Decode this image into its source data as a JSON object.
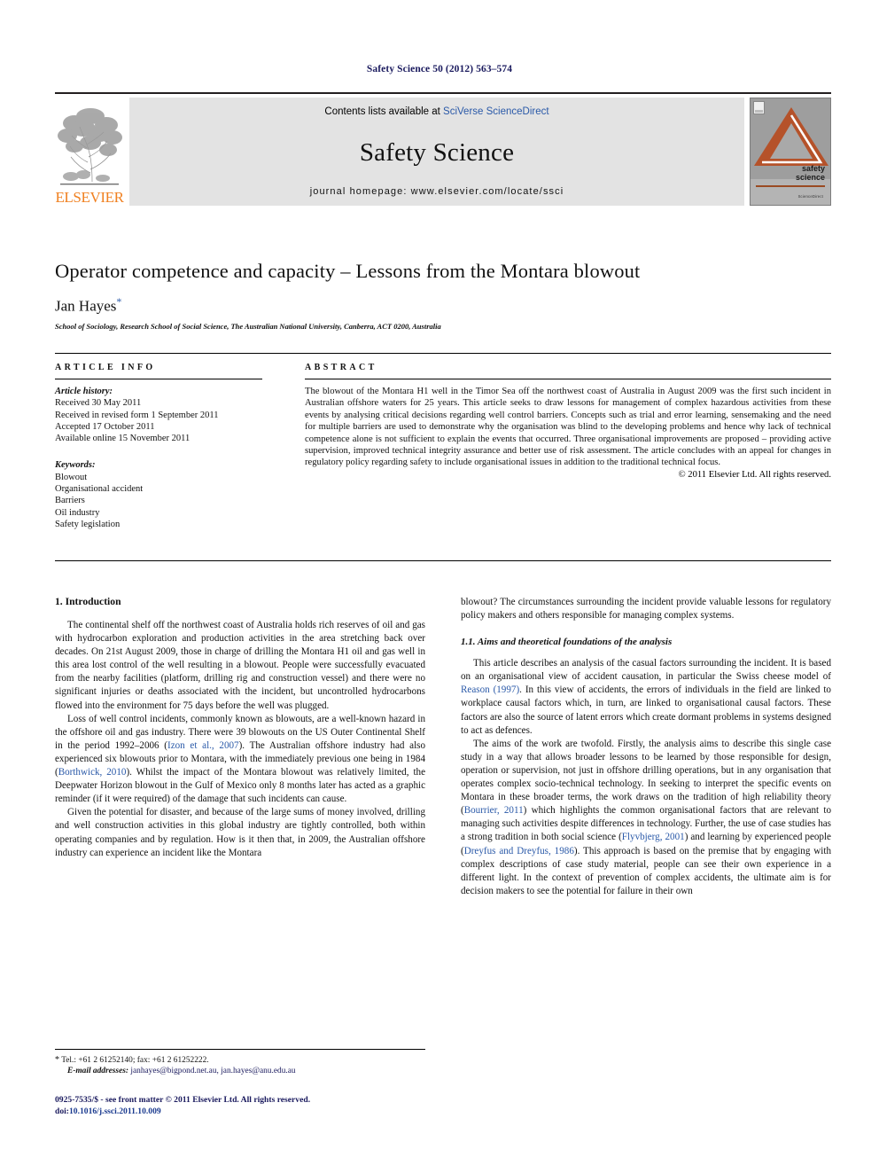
{
  "running_head": "Safety Science 50 (2012) 563–574",
  "banner": {
    "publisher_logo_name": "elsevier-tree-logo",
    "publisher_wordmark": "ELSEVIER",
    "contents_prefix": "Contents lists available at ",
    "contents_link": "SciVerse ScienceDirect",
    "journal_name": "Safety Science",
    "homepage_label": "journal homepage: www.elsevier.com/locate/ssci",
    "cover": {
      "title_line1": "safety",
      "title_line2": "science",
      "footer": "ScienceDirect"
    }
  },
  "article": {
    "title": "Operator competence and capacity – Lessons from the Montara blowout",
    "authors": "Jan Hayes",
    "corresponding_marker": "*",
    "affiliation": "School of Sociology, Research School of Social Science, The Australian National University, Canberra, ACT 0200, Australia"
  },
  "article_info": {
    "heading": "ARTICLE INFO",
    "history_label": "Article history:",
    "history": [
      "Received 30 May 2011",
      "Received in revised form 1 September 2011",
      "Accepted 17 October 2011",
      "Available online 15 November 2011"
    ],
    "keywords_label": "Keywords:",
    "keywords": [
      "Blowout",
      "Organisational accident",
      "Barriers",
      "Oil industry",
      "Safety legislation"
    ]
  },
  "abstract": {
    "heading": "ABSTRACT",
    "text": "The blowout of the Montara H1 well in the Timor Sea off the northwest coast of Australia in August 2009 was the first such incident in Australian offshore waters for 25 years. This article seeks to draw lessons for management of complex hazardous activities from these events by analysing critical decisions regarding well control barriers. Concepts such as trial and error learning, sensemaking and the need for multiple barriers are used to demonstrate why the organisation was blind to the developing problems and hence why lack of technical competence alone is not sufficient to explain the events that occurred. Three organisational improvements are proposed – providing active supervision, improved technical integrity assurance and better use of risk assessment. The article concludes with an appeal for changes in regulatory policy regarding safety to include organisational issues in addition to the traditional technical focus.",
    "copyright": "© 2011 Elsevier Ltd. All rights reserved."
  },
  "body": {
    "section1_heading": "1. Introduction",
    "left_paragraphs": [
      "The continental shelf off the northwest coast of Australia holds rich reserves of oil and gas with hydrocarbon exploration and production activities in the area stretching back over decades. On 21st August 2009, those in charge of drilling the Montara H1 oil and gas well in this area lost control of the well resulting in a blowout. People were successfully evacuated from the nearby facilities (platform, drilling rig and construction vessel) and there were no significant injuries or deaths associated with the incident, but uncontrolled hydrocarbons flowed into the environment for 75 days before the well was plugged."
    ],
    "left_para2_a": "Loss of well control incidents, commonly known as blowouts, are a well-known hazard in the offshore oil and gas industry. There were 39 blowouts on the US Outer Continental Shelf in the period 1992–2006 (",
    "left_para2_cite1": "Izon et al., 2007",
    "left_para2_b": "). The Australian offshore industry had also experienced six blowouts prior to Montara, with the immediately previous one being in 1984 (",
    "left_para2_cite2": "Borthwick, 2010",
    "left_para2_c": "). Whilst the impact of the Montara blowout was relatively limited, the Deepwater Horizon blowout in the Gulf of Mexico only 8 months later has acted as a graphic reminder (if it were required) of the damage that such incidents can cause.",
    "left_para3": "Given the potential for disaster, and because of the large sums of money involved, drilling and well construction activities in this global industry are tightly controlled, both within operating companies and by regulation. How is it then that, in 2009, the Australian offshore industry can experience an incident like the Montara",
    "right_para1": "blowout? The circumstances surrounding the incident provide valuable lessons for regulatory policy makers and others responsible for managing complex systems.",
    "section11_heading": "1.1. Aims and theoretical foundations of the analysis",
    "right_para2_a": "This article describes an analysis of the casual factors surrounding the incident. It is based on an organisational view of accident causation, in particular the Swiss cheese model of ",
    "right_para2_cite1": "Reason (1997)",
    "right_para2_b": ". In this view of accidents, the errors of individuals in the field are linked to workplace causal factors which, in turn, are linked to organisational causal factors. These factors are also the source of latent errors which create dormant problems in systems designed to act as defences.",
    "right_para3_a": "The aims of the work are twofold. Firstly, the analysis aims to describe this single case study in a way that allows broader lessons to be learned by those responsible for design, operation or supervision, not just in offshore drilling operations, but in any organisation that operates complex socio-technical technology. In seeking to interpret the specific events on Montara in these broader terms, the work draws on the tradition of high reliability theory (",
    "right_para3_cite1": "Bourrier, 2011",
    "right_para3_b": ") which highlights the common organisational factors that are relevant to managing such activities despite differences in technology. Further, the use of case studies has a strong tradition in both social science (",
    "right_para3_cite2": "Flyvbjerg, 2001",
    "right_para3_c": ") and learning by experienced people (",
    "right_para3_cite3": "Dreyfus and Dreyfus, 1986",
    "right_para3_d": "). This approach is based on the premise that by engaging with complex descriptions of case study material, people can see their own experience in a different light. In the context of prevention of complex accidents, the ultimate aim is for decision makers to see the potential for failure in their own"
  },
  "footnote": {
    "marker": "*",
    "tel_fax": "Tel.: +61 2 61252140; fax: +61 2 61252222.",
    "email_label": "E-mail addresses:",
    "emails": "janhayes@bigpond.net.au, jan.hayes@anu.edu.au"
  },
  "frontmatter": {
    "issn_line": "0925-7535/$ - see front matter © 2011 Elsevier Ltd. All rights reserved.",
    "doi_label": "doi:",
    "doi_value": "10.1016/j.ssci.2011.10.009"
  },
  "colors": {
    "navy": "#1a1a5e",
    "link_blue": "#2a59a8",
    "elsevier_orange": "#f08020",
    "cover_rust": "#b5522a",
    "banner_gray": "#e3e3e3"
  }
}
